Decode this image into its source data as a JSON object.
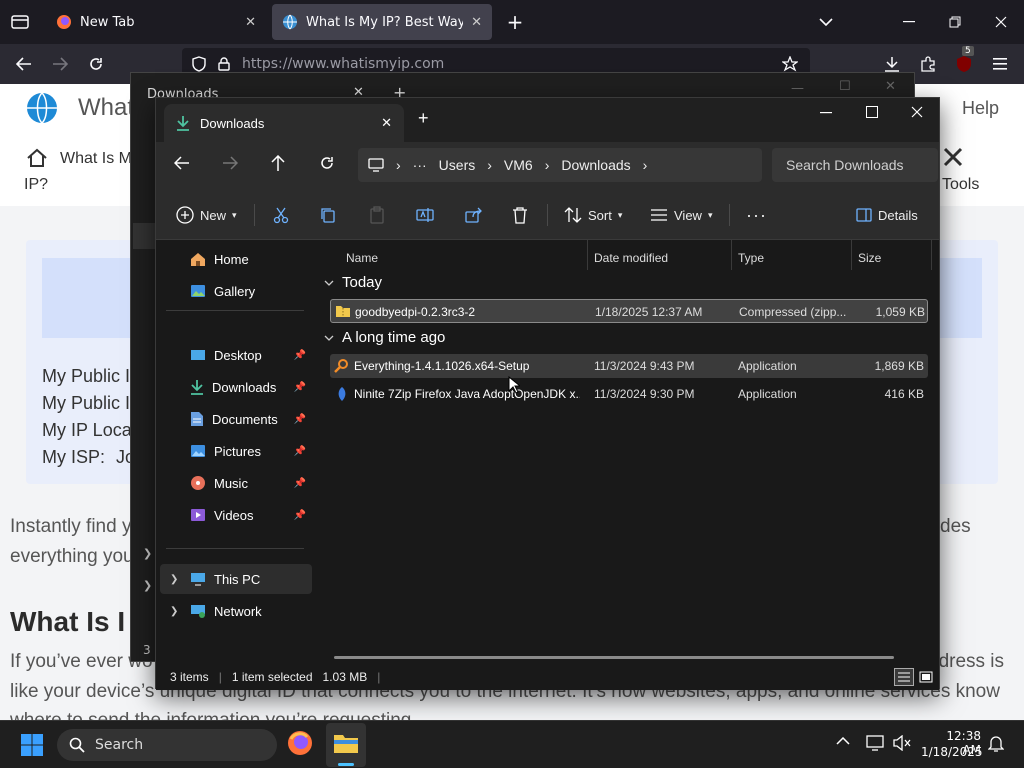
{
  "browser": {
    "tabs": [
      {
        "title": "New Tab",
        "active": false
      },
      {
        "title": "What Is My IP? Best Way To Che",
        "active": true
      }
    ],
    "url": "https://www.whatismyip.com",
    "badge_count": "5"
  },
  "website": {
    "logo_text": "What",
    "nav_help": "Help",
    "nav_what_is_my_line1": "What Is M",
    "nav_what_is_my_line2": "IP?",
    "nav_tools": "Tools",
    "rows": [
      "My Public I",
      "My Public I",
      "My IP Locat",
      "My ISP:"
    ],
    "isp_value": "Jo",
    "intro_line1": "Instantly find y",
    "intro_right": "des",
    "intro_line2": "everything you",
    "heading": "What Is I",
    "para_left": "If you’ve ever wo",
    "para_right": "ddress is",
    "para_line2": "like your device’s unique digital ID that connects you to the internet. It’s how websites, apps, and online services know",
    "para_line3": "where to send the information you’re requesting.",
    "left_char": "3"
  },
  "behind_window": {
    "title": "Downloads"
  },
  "explorer": {
    "tab_title": "Downloads",
    "breadcrumb": [
      "Users",
      "VM6",
      "Downloads"
    ],
    "search_placeholder": "Search Downloads",
    "toolbar": {
      "new_label": "New",
      "sort_label": "Sort",
      "view_label": "View",
      "details_label": "Details"
    },
    "nav_items": [
      {
        "label": "Home",
        "icon": "home-icon"
      },
      {
        "label": "Gallery",
        "icon": "gallery-icon"
      },
      {
        "label": "Desktop",
        "icon": "desktop-icon",
        "pinned": true
      },
      {
        "label": "Downloads",
        "icon": "downloads-icon",
        "pinned": true
      },
      {
        "label": "Documents",
        "icon": "documents-icon",
        "pinned": true
      },
      {
        "label": "Pictures",
        "icon": "pictures-icon",
        "pinned": true
      },
      {
        "label": "Music",
        "icon": "music-icon",
        "pinned": true
      },
      {
        "label": "Videos",
        "icon": "videos-icon",
        "pinned": true
      },
      {
        "label": "This PC",
        "icon": "this-pc-icon"
      },
      {
        "label": "Network",
        "icon": "network-icon"
      }
    ],
    "columns": [
      "Name",
      "Date modified",
      "Type",
      "Size"
    ],
    "groups": [
      {
        "label": "Today",
        "files": [
          {
            "name": "goodbyedpi-0.2.3rc3-2",
            "date": "1/18/2025 12:37 AM",
            "type": "Compressed (zipp...",
            "size": "1,059 KB",
            "selected": true
          }
        ]
      },
      {
        "label": "A long time ago",
        "files": [
          {
            "name": "Everything-1.4.1.1026.x64-Setup",
            "date": "11/3/2024 9:43 PM",
            "type": "Application",
            "size": "1,869 KB",
            "hovered": true
          },
          {
            "name": "Ninite 7Zip Firefox Java AdoptOpenJDK x...",
            "date": "11/3/2024 9:30 PM",
            "type": "Application",
            "size": "416 KB"
          }
        ]
      }
    ],
    "status": {
      "items": "3 items",
      "selected": "1 item selected",
      "size": "1.03 MB"
    }
  },
  "taskbar": {
    "search_label": "Search",
    "time": "12:38 AM",
    "date": "1/18/2025"
  },
  "colors": {
    "explorer_bg": "#191919",
    "accent": "#4cc2ff",
    "firefox_bar": "#2b2a33"
  }
}
